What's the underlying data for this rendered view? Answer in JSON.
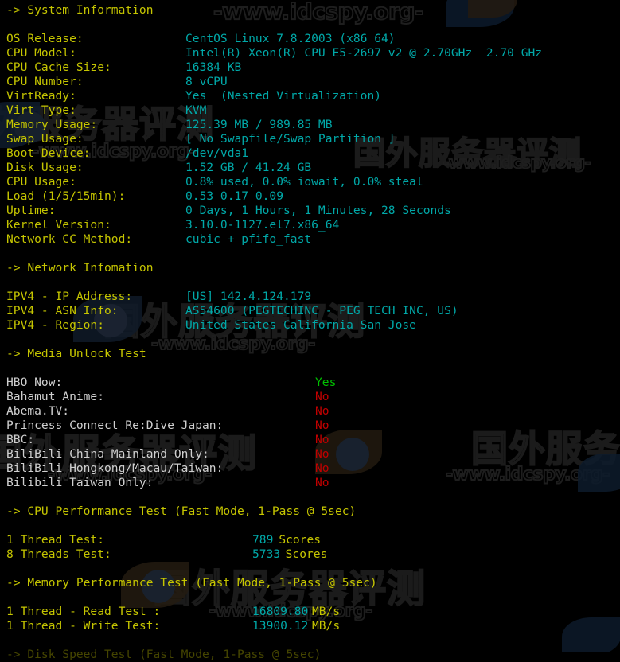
{
  "terminal": {
    "colors": {
      "background": "#000000",
      "label": "#c5c500",
      "value": "#00a8a8",
      "plain": "#cfcfcf",
      "yes": "#00c000",
      "no": "#c00000"
    },
    "sections": [
      {
        "header": "-> System Information",
        "rows": [
          {
            "label": "OS Release:",
            "value": "CentOS Linux 7.8.2003 (x86_64)"
          },
          {
            "label": "CPU Model:",
            "value": "Intel(R) Xeon(R) CPU E5-2697 v2 @ 2.70GHz  2.70 GHz"
          },
          {
            "label": "CPU Cache Size:",
            "value": "16384 KB"
          },
          {
            "label": "CPU Number:",
            "value": "8 vCPU"
          },
          {
            "label": "VirtReady:",
            "value": "Yes  (Nested Virtualization)"
          },
          {
            "label": "Virt Type:",
            "value": "KVM"
          },
          {
            "label": "Memory Usage:",
            "value": "125.39 MB / 989.85 MB"
          },
          {
            "label": "Swap Usage:",
            "value": "[ No Swapfile/Swap Partition ]"
          },
          {
            "label": "Boot Device:",
            "value": "/dev/vda1"
          },
          {
            "label": "Disk Usage:",
            "value": "1.52 GB / 41.24 GB"
          },
          {
            "label": "CPU Usage:",
            "value": "0.8% used, 0.0% iowait, 0.0% steal"
          },
          {
            "label": "Load (1/5/15min):",
            "value": "0.53 0.17 0.09"
          },
          {
            "label": "Uptime:",
            "value": "0 Days, 1 Hours, 1 Minutes, 28 Seconds"
          },
          {
            "label": "Kernel Version:",
            "value": "3.10.0-1127.el7.x86_64"
          },
          {
            "label": "Network CC Method:",
            "value": "cubic + pfifo_fast"
          }
        ]
      },
      {
        "header": "-> Network Infomation",
        "rows": [
          {
            "label": "IPV4 - IP Address:",
            "value": "[US] 142.4.124.179"
          },
          {
            "label": "IPV4 - ASN Info:",
            "value": "AS54600 (PEGTECHINC - PEG TECH INC, US)"
          },
          {
            "label": "IPV4 - Region:",
            "value": "United States California San Jose"
          }
        ]
      },
      {
        "header": "-> Media Unlock Test",
        "rows": [
          {
            "label": "HBO Now:",
            "value": "Yes",
            "state": "yes"
          },
          {
            "label": "Bahamut Anime:",
            "value": "No",
            "state": "no"
          },
          {
            "label": "Abema.TV:",
            "value": "No",
            "state": "no"
          },
          {
            "label": "Princess Connect Re:Dive Japan:",
            "value": "No",
            "state": "no"
          },
          {
            "label": "BBC:",
            "value": "No",
            "state": "no"
          },
          {
            "label": "BiliBili China Mainland Only:",
            "value": "No",
            "state": "no"
          },
          {
            "label": "BiliBili Hongkong/Macau/Taiwan:",
            "value": "No",
            "state": "no"
          },
          {
            "label": "Bilibili Taiwan Only:",
            "value": "No",
            "state": "no"
          }
        ]
      },
      {
        "header": "-> CPU Performance Test (Fast Mode, 1-Pass @ 5sec)",
        "rows": [
          {
            "label": "1 Thread Test:",
            "value": "789",
            "unit": "Scores"
          },
          {
            "label": "8 Threads Test:",
            "value": "5733",
            "unit": "Scores"
          }
        ]
      },
      {
        "header": "-> Memory Performance Test (Fast Mode, 1-Pass @ 5sec)",
        "rows": [
          {
            "label": "1 Thread - Read Test :",
            "value": "16809.80",
            "unit": "MB/s"
          },
          {
            "label": "1 Thread - Write Test:",
            "value": "13900.12",
            "unit": "MB/s"
          }
        ]
      },
      {
        "header": "-> Disk Speed Test (Fast Mode, 1-Pass @ 5sec)",
        "rows": []
      }
    ]
  },
  "watermark": {
    "chinese": "国外服务器评测",
    "url": "-www.idcspy.org-"
  }
}
